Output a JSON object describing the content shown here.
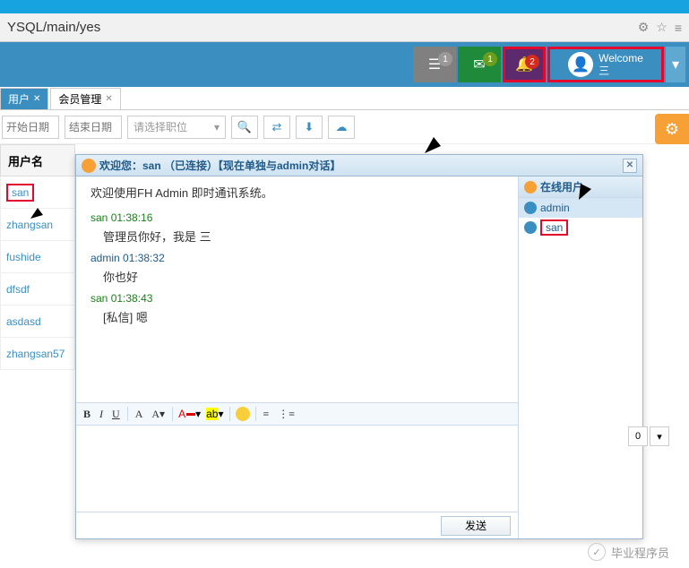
{
  "url": "YSQL/main/yes",
  "header": {
    "msg_badge": "1",
    "mail_badge": "1",
    "bell_badge": "2",
    "welcome_label": "Welcome",
    "welcome_name": "三"
  },
  "tabs": [
    {
      "label": "用户",
      "active": true
    },
    {
      "label": "会员管理",
      "active": false
    }
  ],
  "filters": {
    "start_date": "开始日期",
    "end_date": "结束日期",
    "role_select": "请选择职位"
  },
  "table": {
    "header": "用户名",
    "rows": [
      "san",
      "zhangsan",
      "fushide",
      "dfsdf",
      "asdasd",
      "zhangsan57"
    ]
  },
  "dialog": {
    "title": "欢迎您：san （已连接）【现在单独与admin对话】",
    "welcome_msg": "欢迎使用FH Admin 即时通讯系统。",
    "messages": [
      {
        "from": "san",
        "time": "01:38:16",
        "text": "管理员你好，我是 三",
        "cls": ""
      },
      {
        "from": "admin",
        "time": "01:38:32",
        "text": "你也好",
        "cls": "adm"
      },
      {
        "from": "san",
        "time": "01:38:43",
        "text": "[私信] 嗯",
        "cls": ""
      }
    ],
    "send_label": "发送",
    "online_header": "在线用户",
    "online_users": [
      "admin",
      "san"
    ]
  },
  "pager_default": "0",
  "watermark": "毕业程序员"
}
